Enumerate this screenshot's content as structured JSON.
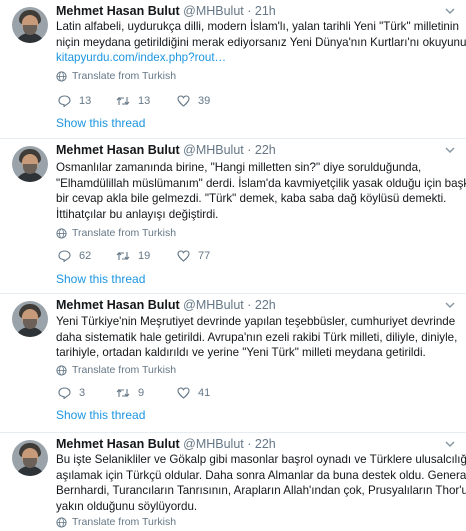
{
  "colors": {
    "link": "#1b95e0",
    "muted": "#657786",
    "text": "#14171a",
    "divider": "#e6ecf0"
  },
  "icons": {
    "reply": "reply-icon",
    "retweet": "retweet-icon",
    "like": "heart-icon",
    "translate": "globe-icon",
    "menu": "chevron-down-icon"
  },
  "tweets": [
    {
      "name": "Mehmet Hasan Bulut",
      "handle": "@MHBulut",
      "dot": "·",
      "time": "21h",
      "lines": [
        "Latin alfabeli, uydurukça dilli, modern İslam'lı, yalan tarihli Yeni \"Türk\" milletinin",
        "niçin meydana getirildiğini merak ediyorsanız Yeni Dünya'nın Kurtları'nı okuyunuz."
      ],
      "link": "kitapyurdu.com/index.php?rout…",
      "translate": "Translate from Turkish",
      "replies": "13",
      "retweets": "13",
      "likes": "39",
      "show_thread": "Show this thread"
    },
    {
      "name": "Mehmet Hasan Bulut",
      "handle": "@MHBulut",
      "dot": "·",
      "time": "22h",
      "lines": [
        "Osmanlılar zamanında birine, \"Hangi milletten sin?\" diye sorulduğunda,",
        "\"Elhamdülillah müslümanım\" derdi. İslam'da kavmiyetçilik yasak olduğu için başka",
        "bir cevap akla bile gelmezdi. \"Türk\" demek, kaba saba dağ köylüsü demekti.",
        "İttihatçılar bu anlayışı değiştirdi."
      ],
      "translate": "Translate from Turkish",
      "replies": "62",
      "retweets": "19",
      "likes": "77",
      "show_thread": "Show this thread"
    },
    {
      "name": "Mehmet Hasan Bulut",
      "handle": "@MHBulut",
      "dot": "·",
      "time": "22h",
      "lines": [
        "Yeni Türkiye'nin Meşrutiyet devrinde yapılan teşebbüsler, cumhuriyet devrinde",
        "daha sistematik hale getirildi. Avrupa'nın ezeli rakibi Türk milleti, diliyle, diniyle,",
        "tarihiyle, ortadan kaldırıldı ve yerine \"Yeni Türk\" milleti meydana getirildi."
      ],
      "translate": "Translate from Turkish",
      "replies": "3",
      "retweets": "9",
      "likes": "41",
      "show_thread": "Show this thread"
    },
    {
      "name": "Mehmet Hasan Bulut",
      "handle": "@MHBulut",
      "dot": "·",
      "time": "22h",
      "lines": [
        "Bu işte Selanikliler ve Gökalp gibi masonlar başrol oynadı ve Türklere ulusalcılığı",
        "aşılamak için Türkçü oldular. Daha sonra Almanlar da buna destek oldu. General",
        "Bernhardi, Turancıların Tanrısının, Arapların Allah'ından çok, Prusyalıların Thor'una",
        "yakın olduğunu söylüyordu."
      ],
      "translate": "Translate from Turkish"
    }
  ]
}
